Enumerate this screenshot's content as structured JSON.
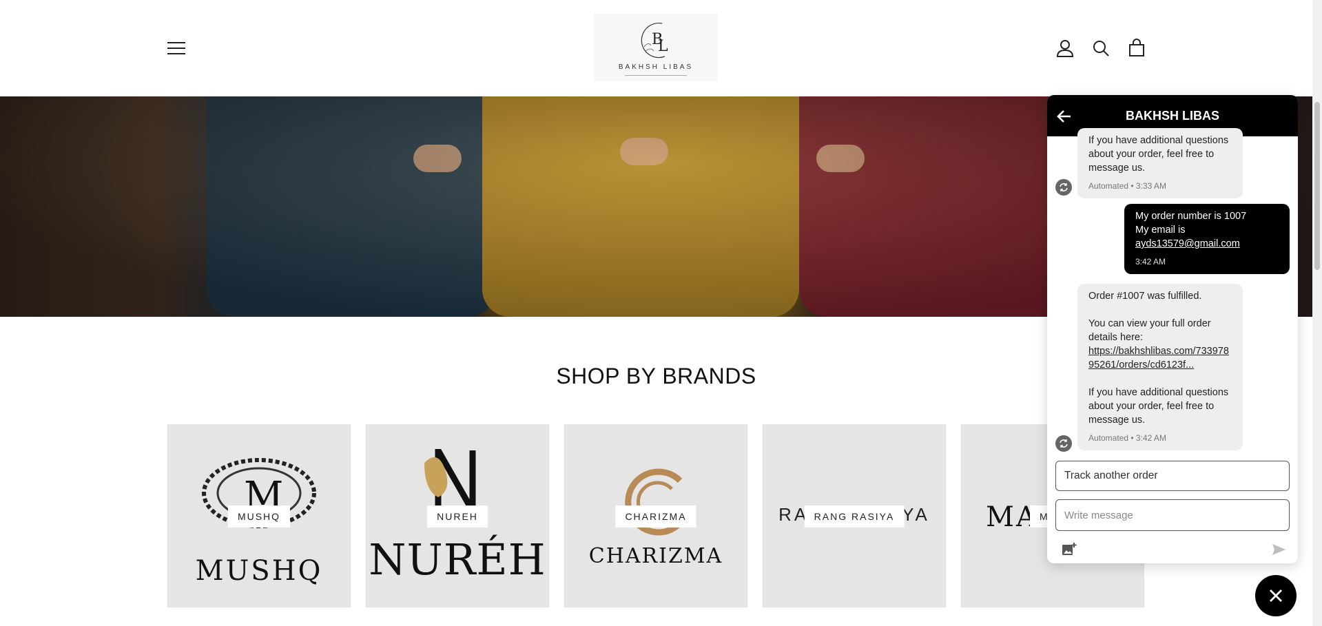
{
  "header": {
    "logo_monogram": "BL",
    "logo_text": "BAKHSH LIBAS",
    "icons": {
      "menu": "hamburger-menu-icon",
      "account": "user-icon",
      "search": "search-icon",
      "cart": "shopping-bag-icon"
    }
  },
  "shop_by_brands": {
    "title": "SHOP BY BRANDS",
    "brands": [
      {
        "label": "MUSHQ",
        "logo_word": "MUSHQ"
      },
      {
        "label": "NUREH",
        "logo_word": "NURÉH"
      },
      {
        "label": "CHARIZMA",
        "logo_word": "CHARIZMA"
      },
      {
        "label": "RANG RASIYA",
        "logo_word": "RANG RASIYA"
      },
      {
        "label": "MA",
        "logo_word": "MA"
      }
    ]
  },
  "chat": {
    "title": "BAKHSH LIBAS",
    "messages": [
      {
        "direction": "in",
        "text": "If you have additional questions about your order, feel free to message us.",
        "meta": "Automated • 3:33 AM"
      },
      {
        "direction": "out",
        "line1": "My order number is 1007",
        "line2": "My email is",
        "email": "ayds13579@gmail.com",
        "meta": "3:42 AM"
      },
      {
        "direction": "in",
        "line1": "Order #1007 was fulfilled.",
        "line2": "You can view your full order details here:",
        "link": "https://bakhshlibas.com/73397895261/orders/cd6123f...",
        "line3": "If you have additional questions about your order, feel free to message us.",
        "meta": "Automated • 3:42 AM"
      }
    ],
    "track_button": "Track another order",
    "input_placeholder": "Write message",
    "icons": {
      "back": "arrow-left-icon",
      "auto": "automated-icon",
      "attach": "image-attach-icon",
      "send": "send-icon",
      "close": "close-icon"
    }
  }
}
